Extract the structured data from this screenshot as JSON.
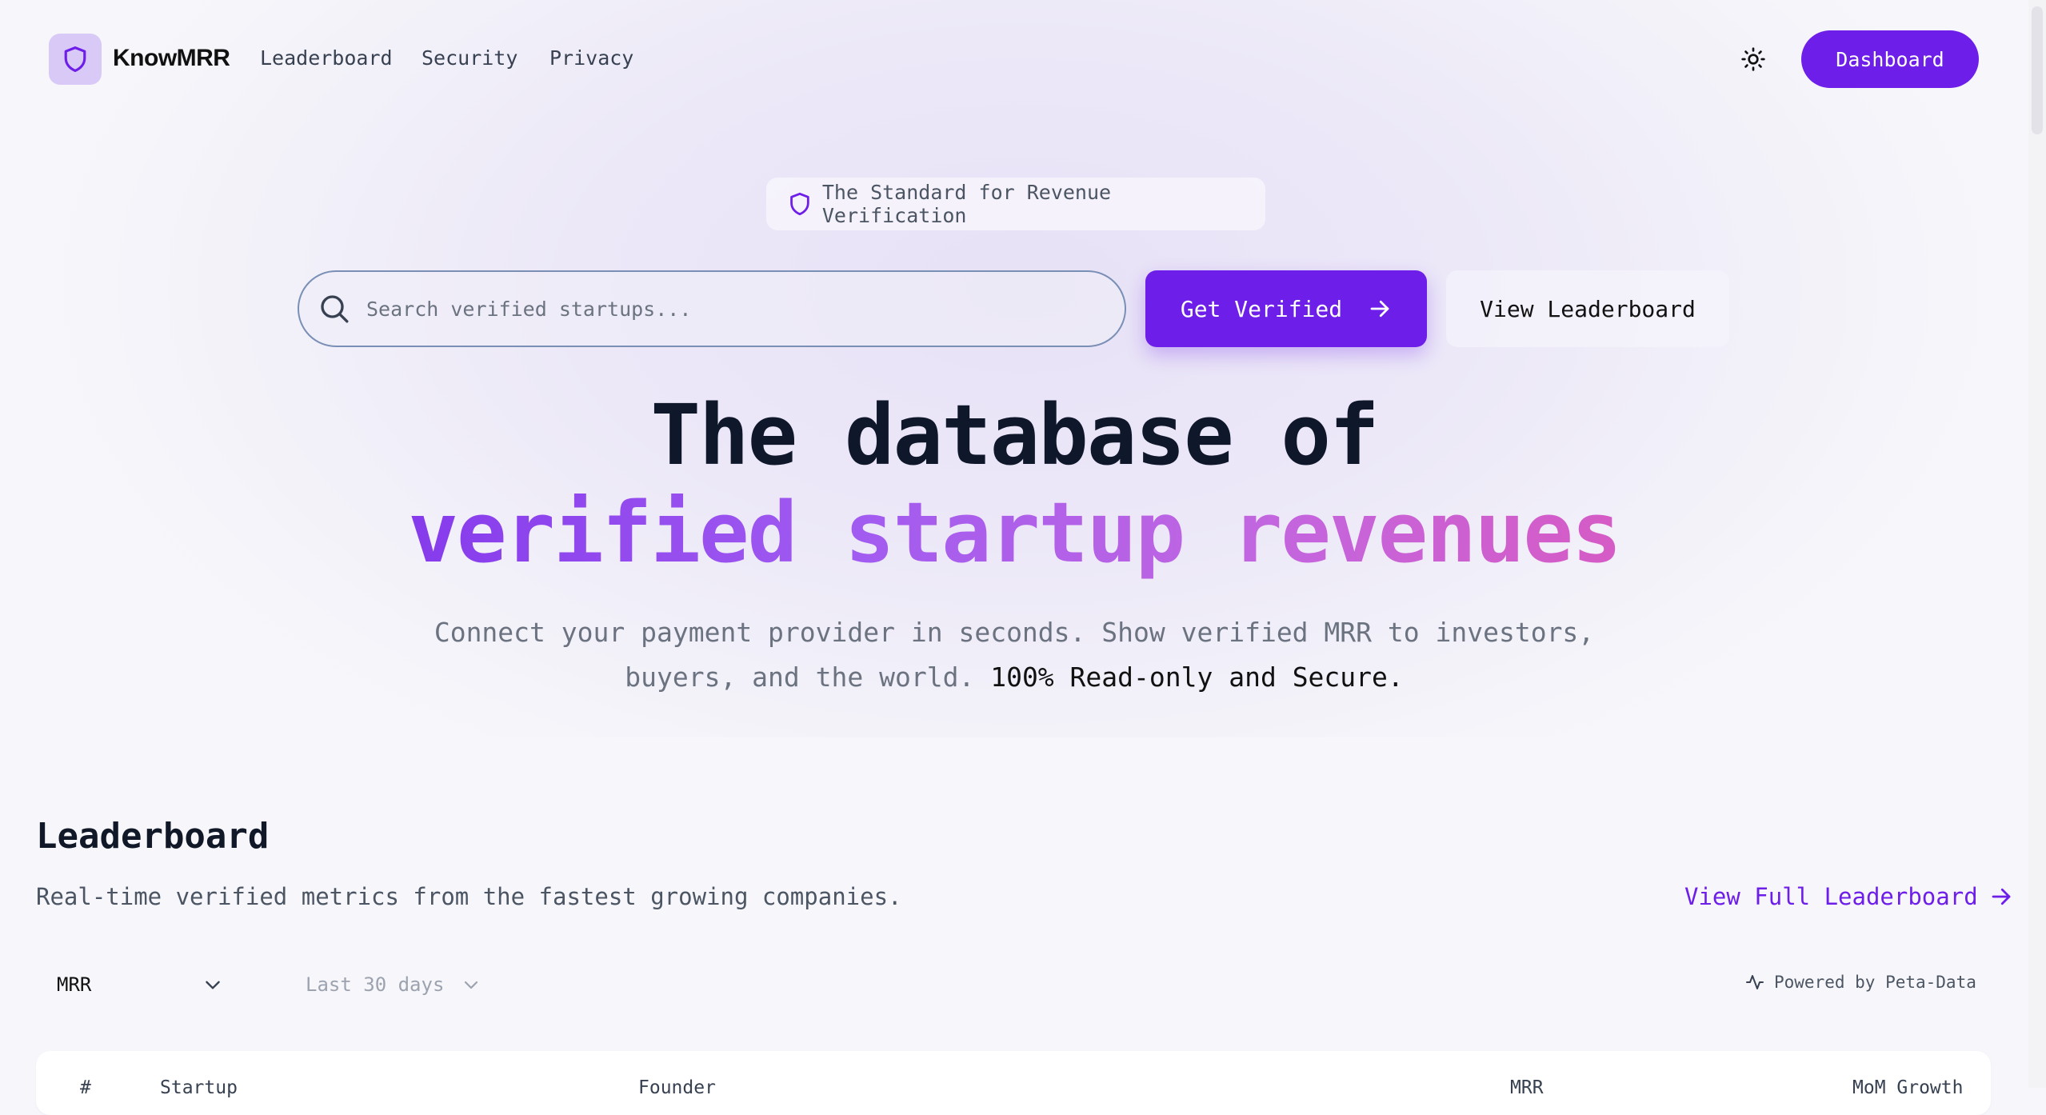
{
  "nav": {
    "brand": "KnowMRR",
    "links": [
      "Leaderboard",
      "Security",
      "Privacy"
    ],
    "dashboard_label": "Dashboard"
  },
  "hero": {
    "badge": "The Standard for Revenue Verification",
    "search_placeholder": "Search verified startups...",
    "get_verified_label": "Get Verified",
    "view_leaderboard_label": "View Leaderboard",
    "headline_line1": "The database of",
    "headline_line2": "verified startup revenues",
    "subtitle_line1": "Connect your payment provider in seconds. Show verified MRR to investors,",
    "subtitle_line2_plain": "buyers, and the world.",
    "subtitle_line2_strong": "100% Read-only and Secure."
  },
  "leaderboard": {
    "title": "Leaderboard",
    "description": "Real-time verified metrics from the fastest growing companies.",
    "full_link": "View Full Leaderboard",
    "metric_select": "MRR",
    "range_select": "Last 30 days",
    "powered_by": "Powered by Peta-Data",
    "columns": [
      "#",
      "Startup",
      "Founder",
      "MRR",
      "MoM Growth"
    ]
  },
  "colors": {
    "accent": "#6d1ee8",
    "gradient_end": "#ec4fa6",
    "page_bg": "#f7f7fb"
  }
}
